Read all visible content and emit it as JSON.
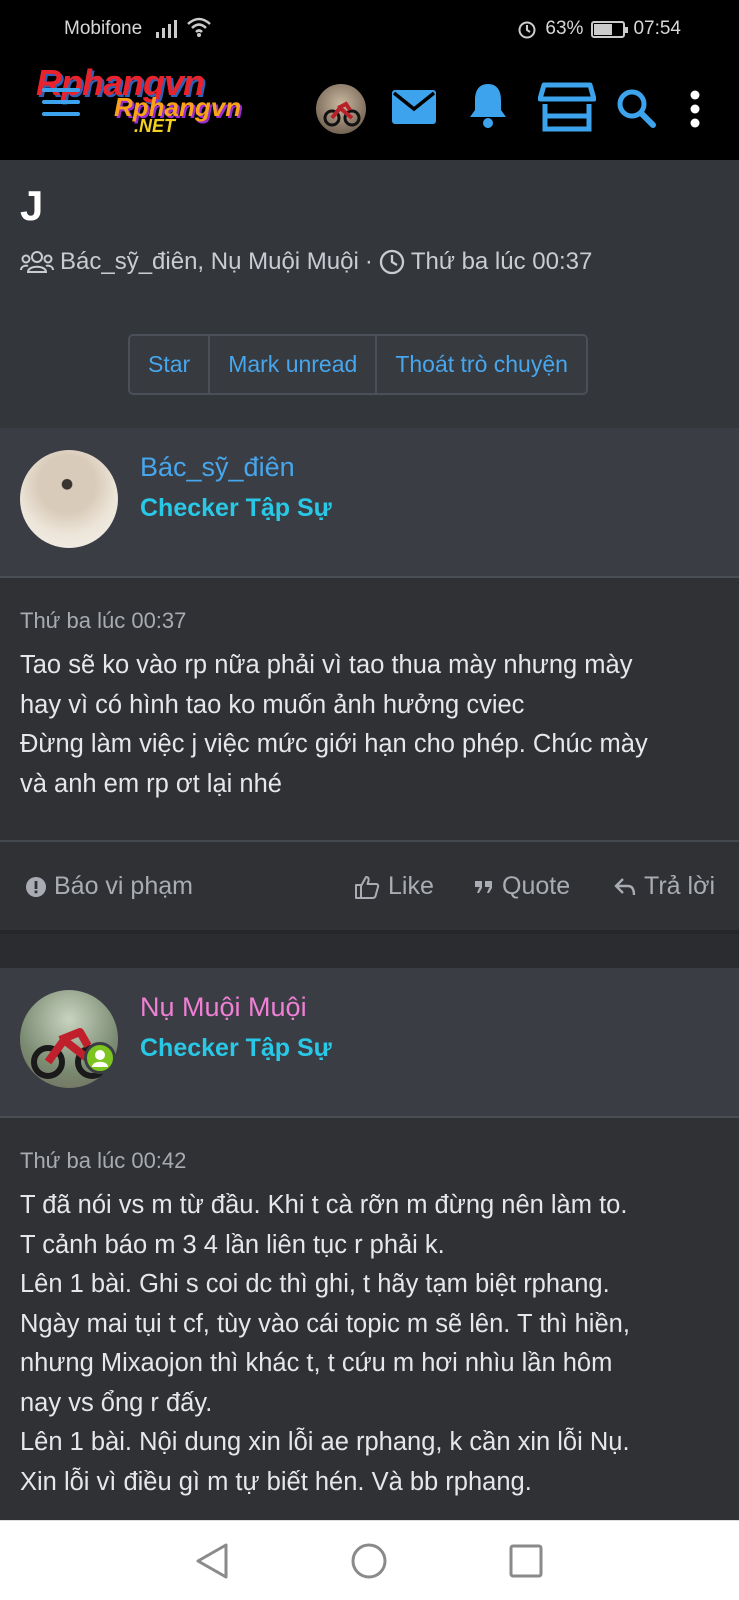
{
  "status": {
    "carrier": "Mobifone",
    "battery": "63%",
    "time": "07:54"
  },
  "header": {
    "logo": "Rphangvn",
    "logo_sub": "Rphangvn",
    "logo_net": ".NET"
  },
  "thread": {
    "title": "J",
    "participants": "Bác_sỹ_điên, Nụ Muội Muội",
    "separator": "·",
    "time": "Thứ ba lúc 00:37",
    "buttons": [
      "Star",
      "Mark unread",
      "Thoát trò chuyện"
    ]
  },
  "posts": [
    {
      "username": "Bác_sỹ_điên",
      "role": "Checker Tập Sự",
      "time": "Thứ ba lúc 00:37",
      "lines": [
        "Tao sẽ ko vào rp nữa phải vì tao thua mày nhưng mày",
        "hay vì có hình tao ko muốn ảnh hưởng cviec",
        "Đừng làm việc j việc mức giới hạn cho phép. Chúc mày",
        "và anh em rp ơt lại nhé"
      ],
      "actions": {
        "report": "Báo vi phạm",
        "like": "Like",
        "quote": "Quote",
        "reply": "Trả lời"
      }
    },
    {
      "username": "Nụ Muội Muội",
      "role": "Checker Tập Sự",
      "time": "Thứ ba lúc 00:42",
      "lines": [
        "T đã nói vs m từ đầu. Khi t cà rỡn m đừng nên làm to.",
        "T cảnh báo m 3 4 lần liên tục r phải k.",
        "Lên 1 bài. Ghi s coi dc thì ghi, t hãy tạm biệt rphang.",
        "Ngày mai tụi t cf, tùy vào cái topic m sẽ lên. T thì hiền,",
        "nhưng Mixaojon thì khác t, t cứu m hơi nhìu lần hôm",
        "nay vs ổng r đấy.",
        "Lên 1 bài. Nội dung xin lỗi ae rphang, k cần xin lỗi Nụ.",
        "Xin lỗi vì điều gì m tự biết hén. Và bb rphang."
      ]
    }
  ],
  "colors": {
    "accent": "#3da3ec",
    "username1": "#46a6ee",
    "username2": "#f07fd6",
    "role": "#28c8e6",
    "online": "#7cc41f"
  }
}
